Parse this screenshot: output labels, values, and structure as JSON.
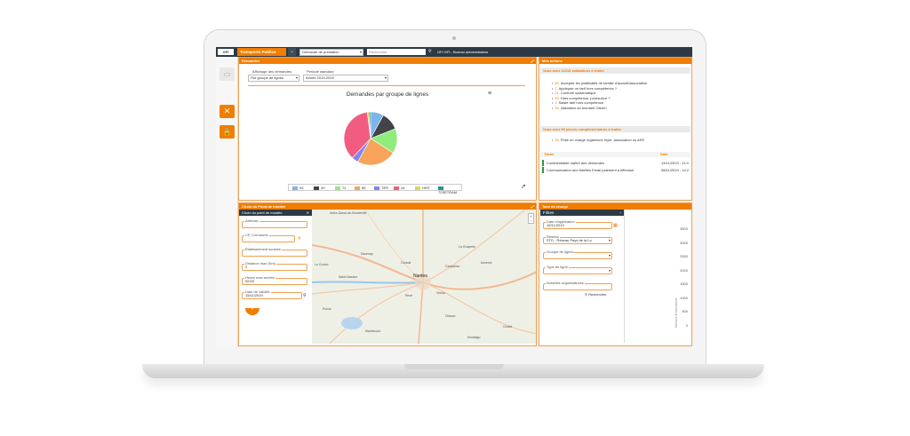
{
  "topbar": {
    "logo": "GFI",
    "app_name": "Transports Publics",
    "menu_icon": "chevron-down-icon",
    "prestation_select": "Demande de prestation",
    "search_placeholder": "Rechercher",
    "search_icon": "search-icon",
    "user_label": "GFI GFI - Bureau administrateur"
  },
  "sidebar": {
    "items": [
      {
        "icon": "monitor-icon"
      },
      {
        "icon": "tools-icon"
      },
      {
        "icon": "lock-icon"
      }
    ],
    "accent_color": "#ef7d00"
  },
  "demandes": {
    "title": "Demandes",
    "affichage_label": "Affichage des demandes",
    "affichage_value": "Par groupe de lignes",
    "periode_label": "Période standard",
    "periode_value": "Année 2019-2020",
    "menu_icon": "hamburger-menu-icon"
  },
  "chart_data": {
    "type": "pie",
    "title": "Demandes par groupe de lignes",
    "categories": [
      "53",
      "49",
      "72",
      "85",
      "TER",
      "44",
      "HIST",
      "72SETRAM"
    ],
    "values": [
      8,
      11,
      15,
      24,
      4,
      36,
      1,
      1
    ],
    "colors": [
      "#7cb5ec",
      "#434348",
      "#90ed7d",
      "#f7a35c",
      "#8085e9",
      "#f15c80",
      "#e4d354",
      "#2b908f"
    ],
    "legend_position": "bottom"
  },
  "mes_actions": {
    "title": "Mes actions",
    "validations_header": "Vous avez 11213 validations à traiter",
    "validations": [
      {
        "count": "83",
        "label": "Accepter les justificatifs de famille d'accueil/association"
      },
      {
        "count": "1",
        "label": "Appliquer un tarif hors compétence ?"
      },
      {
        "count": "21",
        "label": "Contrôle systématique"
      },
      {
        "count": "30",
        "label": "Hors compétence, poursuivre ?"
      },
      {
        "count": "1",
        "label": "Saisie tarif hors compétence"
      },
      {
        "count": "30",
        "label": "Validation du montant Citizen"
      }
    ],
    "pieces_header": "Vous avez 90 pièces complémentaires à traiter",
    "pieces": [
      {
        "count": "90",
        "label": "Prise en charge organisme foyer, association ou ASE"
      }
    ],
    "table_headers": [
      "Tâche",
      "Date"
    ],
    "tasks": [
      {
        "label": "Confidentialité maître des demandes",
        "date": "14/11/2019 - 11:3"
      },
      {
        "label": "Communication aux familles Email paiement à effectuer",
        "date": "08/11/2019 - 14:2"
      }
    ]
  },
  "choix_point": {
    "title": "Choix du Point de montée",
    "subpanel_title": "Choix du point de montée",
    "close_icon": "close-icon",
    "fields": [
      {
        "label": "Adresse",
        "value": ""
      },
      {
        "label": "CP, Commune",
        "value": ""
      },
      {
        "label": "Établissement scolaire",
        "value": ""
      },
      {
        "label": "Distance max (Km)",
        "value": "2"
      },
      {
        "label": "Heure max arrivée",
        "value": "09:00"
      },
      {
        "label": "Date de validité",
        "value": "15/11/2019"
      }
    ],
    "collapse_icon": "chevron-up-icon",
    "map_labels": [
      "Notre-Dame-de-Bondeville",
      "Nantes",
      "Le Croisic",
      "Saint-Nazaire",
      "Ancenis",
      "Clisson",
      "Machecoul",
      "Vertou",
      "Rezé",
      "Orvault",
      "Carquefou",
      "Savenay",
      "Pornic",
      "Cholet",
      "La Chapelle",
      "Montaigu"
    ]
  },
  "taux_charge": {
    "title": "Taux de charge",
    "filtres_label": "Filtres",
    "fields": [
      {
        "label": "Date d'application",
        "value": "15/11/2019"
      },
      {
        "label": "Réseau",
        "value": "STD - Réseau Pays de la Lo"
      },
      {
        "label": "Groupe de lignes",
        "value": ""
      },
      {
        "label": "Type de ligne",
        "value": ""
      },
      {
        "label": "Autorités organisatrices",
        "value": ""
      }
    ],
    "search_button": "Rechercher",
    "y_ticks": [
      "3500",
      "3000",
      "2500",
      "2000",
      "1500",
      "1000",
      "500",
      "0"
    ],
    "y_axis_label": "Nombre d'inscriptions"
  }
}
